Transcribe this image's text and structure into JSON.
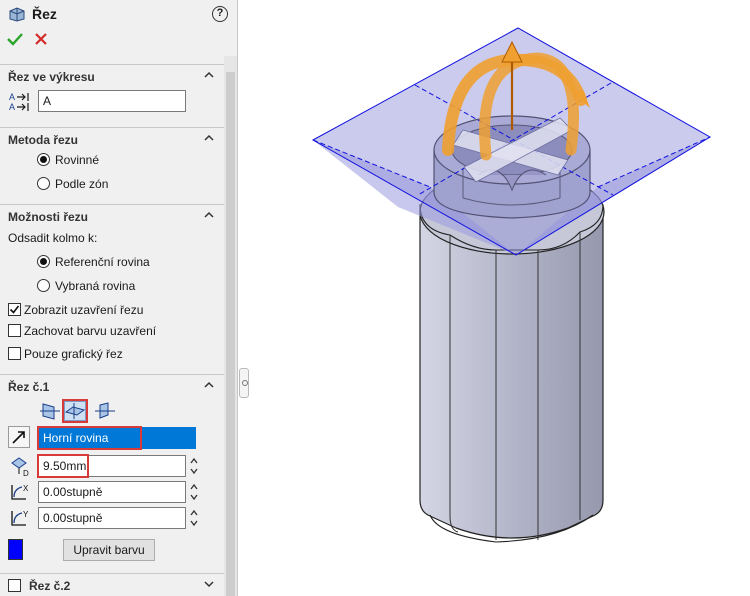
{
  "title": "Řez",
  "help_label": "?",
  "section_view": {
    "header": "Řez ve výkresu",
    "label_icon_text": "A",
    "name_value": "A"
  },
  "method": {
    "header": "Metoda řezu",
    "options": [
      "Rovinné",
      "Podle zón"
    ],
    "selected": "Rovinné"
  },
  "options_section": {
    "header": "Možnosti řezu",
    "offset_label": "Odsadit kolmo k:",
    "radios": [
      "Referenční rovina",
      "Vybraná rovina"
    ],
    "selected": "Referenční rovina",
    "checkboxes": [
      {
        "label": "Zobrazit uzavření řezu",
        "checked": true
      },
      {
        "label": "Zachovat barvu uzavření",
        "checked": false
      },
      {
        "label": "Pouze grafický řez",
        "checked": false
      }
    ]
  },
  "cut1": {
    "header": "Řez č.1",
    "plane_value": "Horní rovina",
    "offset_value": "9.50mm",
    "rot_x_value": "0.00stupně",
    "rot_y_value": "0.00stupně",
    "color_button": "Upravit barvu",
    "color_swatch": "#0000ff"
  },
  "cut2": {
    "header": "Řez č.2"
  },
  "colors": {
    "accent": "#0078d7",
    "highlight": "#d83a3a",
    "plane": "#8c8cd6",
    "model": "#b6b8c9",
    "arrow": "#f0a030"
  }
}
